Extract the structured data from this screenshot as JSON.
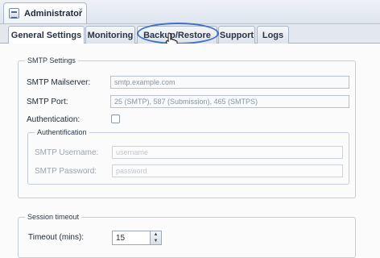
{
  "window": {
    "tab_title": "Administrator",
    "close_symbol": "×",
    "icon": "admin-app-icon"
  },
  "tabs": [
    {
      "label": "General Settings",
      "active": true
    },
    {
      "label": "Monitoring",
      "active": false
    },
    {
      "label": "Backup/Restore",
      "active": false,
      "highlighted": true
    },
    {
      "label": "Support",
      "active": false
    },
    {
      "label": "Logs",
      "active": false
    }
  ],
  "smtp": {
    "legend": "SMTP Settings",
    "mailserver_label": "SMTP Mailserver:",
    "mailserver_placeholder": "smtp.example.com",
    "port_label": "SMTP Port:",
    "port_placeholder": "25 (SMTP), 587 (Submission), 465 (SMTPS)",
    "auth_label": "Authentication:",
    "auth_checked": false,
    "auth_group": {
      "legend": "Authentification",
      "username_label": "SMTP Username:",
      "username_placeholder": "username",
      "password_label": "SMTP Password:",
      "password_placeholder": "password"
    }
  },
  "session": {
    "legend": "Session timeout",
    "timeout_label": "Timeout (mins):",
    "timeout_value": "15",
    "spinner_up": "▲",
    "spinner_down": "▼"
  },
  "colors": {
    "highlight_ring": "#3f6fc6",
    "tab_border": "#a9b6c7"
  }
}
